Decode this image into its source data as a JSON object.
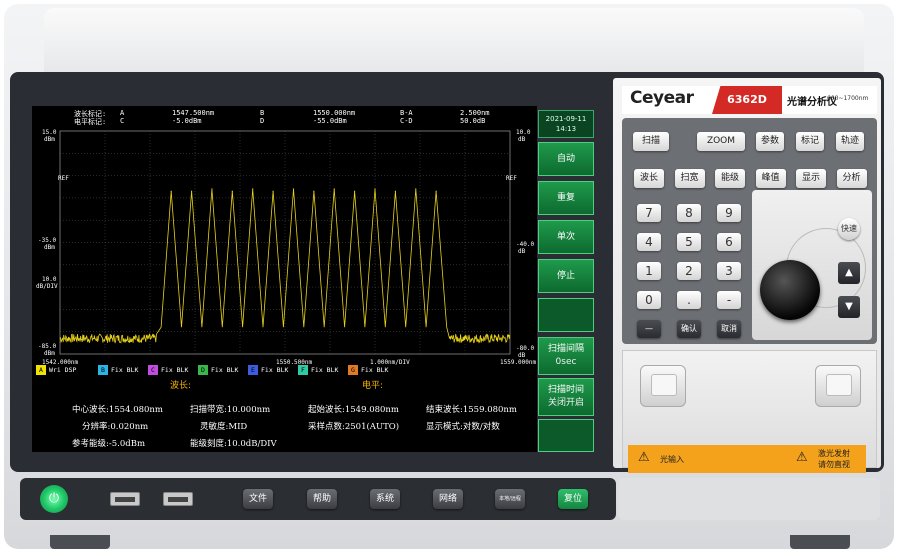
{
  "brand": {
    "logo": "Ceyear",
    "model": "6362D",
    "product_name": "光谱分析仪",
    "range": "600~1700nm"
  },
  "screen": {
    "markers": {
      "row1_label": "波长标记:",
      "row2_label": "电平标记:",
      "a_label": "A",
      "a_wl": "1547.500nm",
      "b_label": "B",
      "b_wl": "1550.000nm",
      "ba_label": "B-A",
      "ba_wl": "2.500nm",
      "c_label": "C",
      "c_lvl": "-5.0dBm",
      "d_label": "D",
      "d_lvl": "-55.0dBm",
      "cd_label": "C-D",
      "cd_lvl": "50.0dB"
    },
    "axis": {
      "y_top": "15.0",
      "y_top_unit": "dBm",
      "ref_left": "REF",
      "y_mid": "-35.0",
      "y_mid_unit": "dBm",
      "y_div": "10.0",
      "y_div_unit": "dB/DIV",
      "y_bottom": "-85.0",
      "y_bottom_unit": "dBm",
      "right_top": "10.0",
      "right_top_unit": "dB",
      "ref_right": "REF",
      "right_mid": "-40.0",
      "right_mid_unit": "dB",
      "right_bottom": "-80.0",
      "right_bottom_unit": "dB",
      "x_start": "1542.000nm",
      "x_center": "1550.500nm",
      "x_div": "1.000nm/DIV",
      "x_end": "1559.000nm"
    },
    "trace_legend": [
      {
        "letter": "A",
        "color": "#f2e200",
        "text": "Wri  DSP"
      },
      {
        "letter": "B",
        "color": "#2ab5e6",
        "text": "Fix  BLK"
      },
      {
        "letter": "C",
        "color": "#c04ce0",
        "text": "Fix  BLK"
      },
      {
        "letter": "D",
        "color": "#38b84a",
        "text": "Fix  BLK"
      },
      {
        "letter": "E",
        "color": "#3c5de0",
        "text": "Fix  BLK"
      },
      {
        "letter": "F",
        "color": "#2fc9a4",
        "text": "Fix  BLK"
      },
      {
        "letter": "G",
        "color": "#e07a24",
        "text": "Fix  BLK"
      }
    ],
    "status": {
      "wavelength_label": "波长:",
      "level_label": "电平:"
    },
    "params": {
      "center": "中心波长:1554.080nm",
      "span": "扫描带宽:10.000nm",
      "start": "起始波长:1549.080nm",
      "stop": "结束波长:1559.080nm",
      "resolution": "分辨率:0.020nm",
      "sensitivity": "灵敏度:MID",
      "points": "采样点数:2501(AUTO)",
      "display_mode": "显示模式:对数/对数",
      "ref_level": "参考能级:-5.0dBm",
      "scale": "能级刻度:10.0dB/DIV"
    },
    "datetime": {
      "date": "2021-09-11",
      "time": "14:13"
    },
    "softkeys": {
      "auto": "自动",
      "repeat": "重复",
      "single": "单次",
      "stop": "停止",
      "interval_label": "扫描间隔",
      "interval_value": "0sec",
      "time_label": "扫描时间",
      "time_value": "关闭开启"
    }
  },
  "panel": {
    "row1": [
      "扫描",
      "ZOOM",
      "参数",
      "标记",
      "轨迹"
    ],
    "row2": [
      "波长",
      "扫宽",
      "能级",
      "峰值",
      "显示",
      "分析"
    ],
    "numpad": [
      "7",
      "8",
      "9",
      "4",
      "5",
      "6",
      "1",
      "2",
      "3",
      "0",
      ".",
      "-"
    ],
    "minus_key": "—",
    "enter_key": "确认",
    "cancel_key": "取消",
    "fast_key": "快速",
    "up_arrow": "▲",
    "down_arrow": "▼"
  },
  "warning": {
    "left": "光输入",
    "right_line1": "激光发射",
    "right_line2": "请勿直视"
  },
  "bottom": {
    "power": "⏻",
    "keys": [
      "文件",
      "帮助",
      "系统",
      "网络",
      "本地/远程",
      "复位"
    ]
  },
  "chart_data": {
    "type": "line",
    "x_range": [
      1542.0,
      1559.0
    ],
    "y_range": [
      -85.0,
      15.0
    ],
    "y_scale": "10.0 dB/DIV",
    "trace_color": "#e8d21a",
    "peaks_nm": [
      1546.2,
      1546.97,
      1547.74,
      1548.51,
      1549.28,
      1550.05,
      1550.82,
      1551.59,
      1552.36,
      1553.13,
      1553.9,
      1554.67,
      1555.44,
      1556.21
    ],
    "peak_levels_dbm": [
      -12,
      -12,
      -11,
      -12,
      -11,
      -12,
      -11,
      -12,
      -11,
      -12,
      -11,
      -12,
      -11,
      -12
    ],
    "valley_level_dbm": -73,
    "noise_floor_dbm": -80
  }
}
